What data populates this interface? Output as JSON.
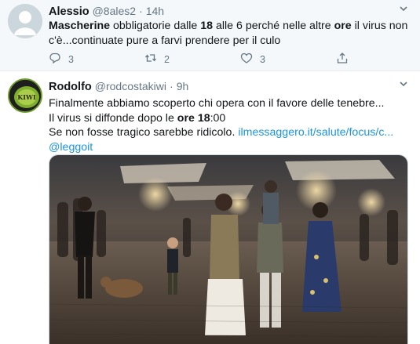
{
  "tweets": [
    {
      "name": "Alessio",
      "handle": "@8ales2",
      "dot": "·",
      "time": "14h",
      "text": {
        "w1": "Mascherine",
        "s1": " obbligatorie dalle ",
        "w2": "18",
        "s2": " alle 6 perché nelle altre ",
        "w3": "ore",
        "s3": " il virus non c'è...continuate pure a farvi prendere per il culo"
      },
      "actions": {
        "reply": "3",
        "retweet": "2",
        "like": "3"
      }
    },
    {
      "name": "Rodolfo",
      "handle": "@rodcostakiwi",
      "dot": "·",
      "time": "9h",
      "avatar_text": "KIWI",
      "text": {
        "line1": "Finalmente abbiamo scoperto chi opera con il favore delle tenebre...",
        "line2_a": "Il virus si diffonde dopo le ",
        "line2_b": "ore",
        "line2_c": " ",
        "line2_d": "18",
        "line2_e": ":00",
        "line3_a": "Se non fosse tragico sarebbe ridicolo. ",
        "link": "ilmessaggero.it/salute/focus/c...",
        "mention": "@leggoit"
      }
    }
  ],
  "icons": [
    "chevron-down-icon",
    "reply-icon",
    "retweet-icon",
    "like-icon",
    "share-icon"
  ],
  "colors": {
    "link": "#1b95e0",
    "muted": "#657786",
    "text": "#14171a",
    "highlight_bg": "#f5f8fa"
  }
}
